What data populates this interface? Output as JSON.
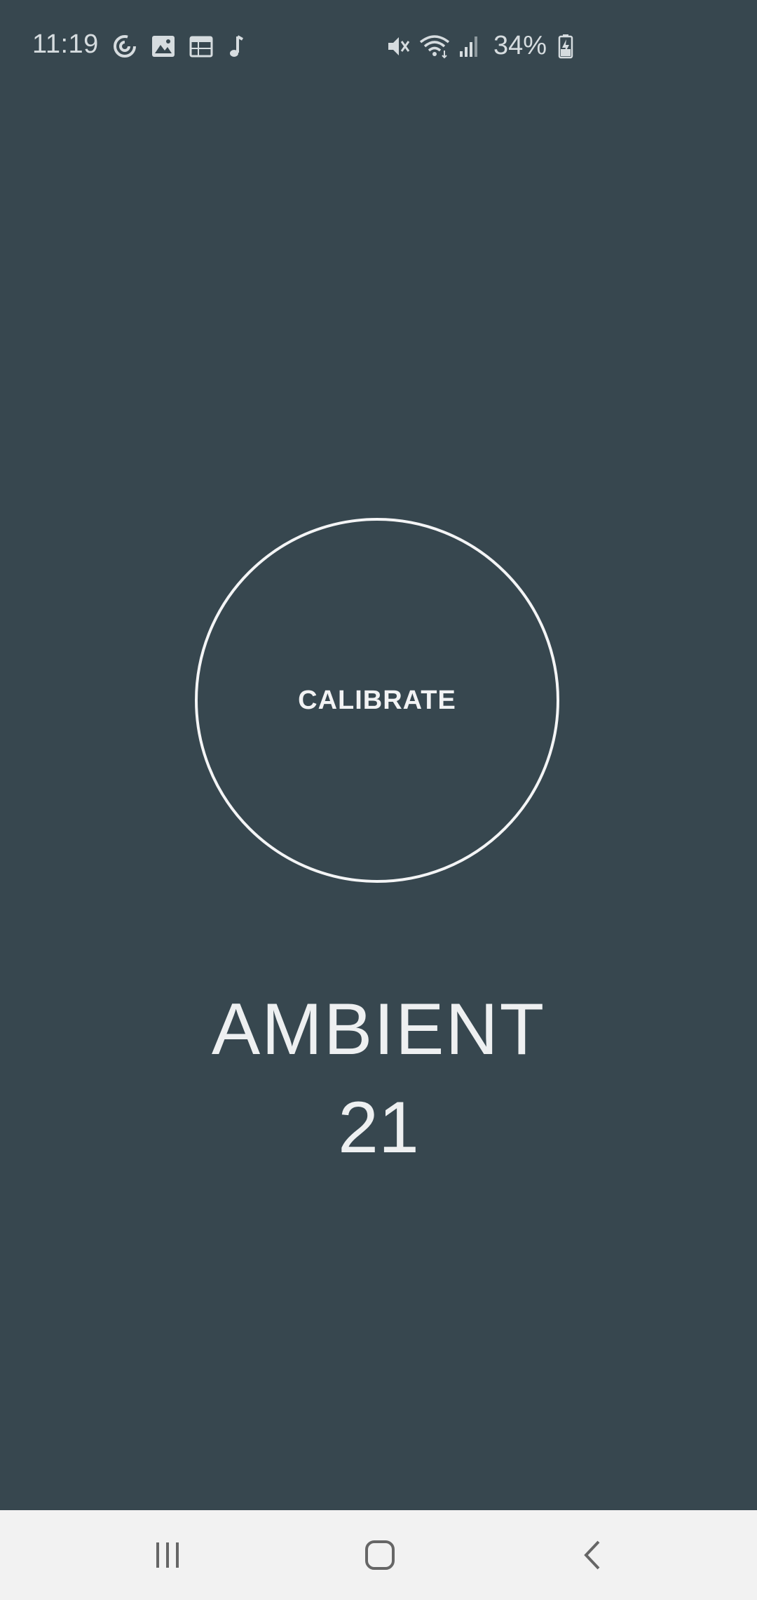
{
  "status_bar": {
    "time": "11:19",
    "left_icons": [
      "pocket-casts-icon",
      "gallery-icon",
      "calendar-icon",
      "music-note-icon"
    ],
    "right_icons": [
      "mute-icon",
      "wifi-icon",
      "signal-icon"
    ],
    "battery_percent": "34%",
    "battery_icon": "battery-charging-icon"
  },
  "main": {
    "calibrate_label": "CALIBRATE",
    "ambient_label": "AMBIENT",
    "ambient_value": "21"
  },
  "nav_bar": {
    "buttons": [
      "recents-icon",
      "home-icon",
      "back-icon"
    ]
  },
  "colors": {
    "background": "#37474f",
    "foreground": "#eef0f1",
    "nav_background": "#f2f2f2",
    "nav_icon": "#666666"
  }
}
